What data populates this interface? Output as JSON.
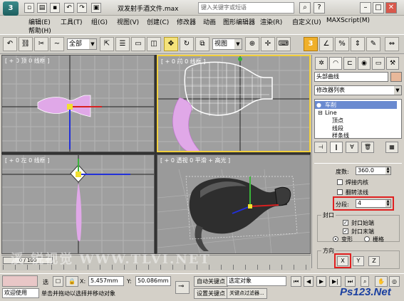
{
  "titlebar": {
    "logo": "3",
    "title": "双发射手酒文件.max",
    "search_placeholder": "键入关键字或短语",
    "buttons": [
      "?",
      "–",
      "□",
      "✕"
    ]
  },
  "menu": {
    "row1": [
      "编辑(E)",
      "工具(T)",
      "组(G)",
      "视图(V)",
      "创建(C)",
      "修改器",
      "动画",
      "图形编辑器",
      "渲染(R)",
      "自定义(U)",
      "MAXScript(M)"
    ],
    "row2": [
      "帮助(H)"
    ]
  },
  "toolbar": {
    "selection_filter": "全部",
    "ref_coord": "视图",
    "snap_label": "3"
  },
  "viewports": {
    "top": "[ + 0 顶 0 线框 ]",
    "front": "[ + 0 前 0 线框 ]",
    "left": "[ + 0 左 0 线框 ]",
    "perspective": "[ + 0 透视 0 平滑 + 高光 ]"
  },
  "panel": {
    "object_name": "头部曲线",
    "modifier_list": "修改器列表",
    "stack": [
      "车削",
      "Line",
      "顶点",
      "线段",
      "样条线"
    ],
    "degrees_label": "度数:",
    "degrees_value": "360.0",
    "weld_core": "焊接内核",
    "flip_normals": "翻转法线",
    "segments_label": "分段:",
    "segments_value": "4",
    "capping_title": "封口",
    "cap_start": "封口始端",
    "cap_end": "封口末端",
    "morph": "变形",
    "grid": "栅格",
    "direction_title": "方向",
    "axis_x": "X",
    "axis_y": "Y",
    "axis_z": "Z"
  },
  "timeline": {
    "frame": "0 / 100"
  },
  "status": {
    "welcome": "欢迎使用",
    "selected": "选",
    "prompt": "单击并拖动以选择并移动对象",
    "x_label": "X:",
    "x_value": "5.457mm",
    "y_label": "Y:",
    "y_value": "50.086mm",
    "autokey": "自动关键点",
    "set_key": "设置关键点",
    "selection_set": "选定对象",
    "key_filters": "关键点过滤器..."
  },
  "watermark": "溪  锐视觉 WWW.TLVI.NET",
  "ps_logo": "Ps123.Net",
  "colors": {
    "active_viewport_border": "#f2d03d",
    "highlight_box": "#e02020",
    "vase_shape": "#e0a8e8"
  }
}
